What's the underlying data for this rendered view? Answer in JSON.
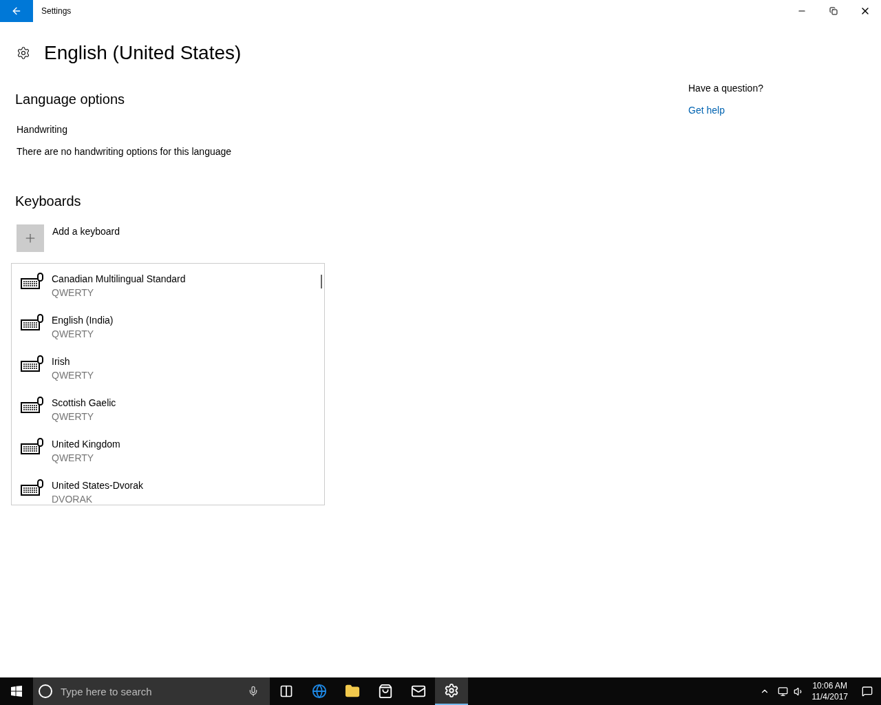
{
  "window": {
    "title": "Settings"
  },
  "page": {
    "title": "English (United States)"
  },
  "language_options": {
    "heading": "Language options",
    "handwriting_label": "Handwriting",
    "handwriting_text": "There are no handwriting options for this language"
  },
  "keyboards": {
    "heading": "Keyboards",
    "add_label": "Add a keyboard",
    "items": [
      {
        "name": "Canadian Multilingual Standard",
        "layout": "QWERTY"
      },
      {
        "name": "English (India)",
        "layout": "QWERTY"
      },
      {
        "name": "Irish",
        "layout": "QWERTY"
      },
      {
        "name": "Scottish Gaelic",
        "layout": "QWERTY"
      },
      {
        "name": "United Kingdom",
        "layout": "QWERTY"
      },
      {
        "name": "United States-Dvorak",
        "layout": "DVORAK"
      }
    ]
  },
  "help": {
    "heading": "Have a question?",
    "link": "Get help"
  },
  "taskbar": {
    "search_placeholder": "Type here to search",
    "apps": [
      {
        "kind": "taskview",
        "selected": false
      },
      {
        "kind": "edge",
        "selected": false
      },
      {
        "kind": "explorer",
        "selected": false
      },
      {
        "kind": "store",
        "selected": false
      },
      {
        "kind": "mail",
        "selected": false
      },
      {
        "kind": "settings",
        "selected": true
      }
    ],
    "time": "10:06 AM",
    "date": "11/4/2017"
  }
}
